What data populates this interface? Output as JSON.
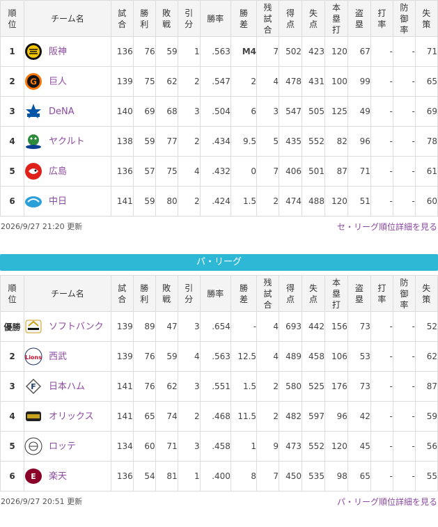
{
  "headers": [
    "順\n位",
    "チーム名",
    "試\n合",
    "勝\n利",
    "敗\n戦",
    "引\n分",
    "勝率",
    "勝\n差",
    "残\n試\n合",
    "得\n点",
    "失\n点",
    "本\n塁\n打",
    "盗\n塁",
    "打\n率",
    "防\n御\n率",
    "失\n策"
  ],
  "central": {
    "rows": [
      {
        "rank": "1",
        "team": "阪神",
        "logo": "tigers",
        "games": "136",
        "wins": "76",
        "losses": "59",
        "draws": "1",
        "pct": ".563",
        "gb": "M4",
        "remaining": "7",
        "runs": "502",
        "allowed": "423",
        "hr": "120",
        "sb": "67",
        "avg": "-",
        "era": "-",
        "errors": "71"
      },
      {
        "rank": "2",
        "team": "巨人",
        "logo": "giants",
        "games": "139",
        "wins": "75",
        "losses": "62",
        "draws": "2",
        "pct": ".547",
        "gb": "2",
        "remaining": "4",
        "runs": "478",
        "allowed": "431",
        "hr": "100",
        "sb": "99",
        "avg": "-",
        "era": "-",
        "errors": "65"
      },
      {
        "rank": "3",
        "team": "DeNA",
        "logo": "baystars",
        "games": "140",
        "wins": "69",
        "losses": "68",
        "draws": "3",
        "pct": ".504",
        "gb": "6",
        "remaining": "3",
        "runs": "547",
        "allowed": "505",
        "hr": "125",
        "sb": "49",
        "avg": "-",
        "era": "-",
        "errors": "69"
      },
      {
        "rank": "4",
        "team": "ヤクルト",
        "logo": "swallows",
        "games": "138",
        "wins": "59",
        "losses": "77",
        "draws": "2",
        "pct": ".434",
        "gb": "9.5",
        "remaining": "5",
        "runs": "435",
        "allowed": "552",
        "hr": "82",
        "sb": "96",
        "avg": "-",
        "era": "-",
        "errors": "78"
      },
      {
        "rank": "5",
        "team": "広島",
        "logo": "carp",
        "games": "136",
        "wins": "57",
        "losses": "75",
        "draws": "4",
        "pct": ".432",
        "gb": "0",
        "remaining": "7",
        "runs": "406",
        "allowed": "501",
        "hr": "87",
        "sb": "71",
        "avg": "-",
        "era": "-",
        "errors": "61"
      },
      {
        "rank": "6",
        "team": "中日",
        "logo": "dragons",
        "games": "141",
        "wins": "59",
        "losses": "80",
        "draws": "2",
        "pct": ".424",
        "gb": "1.5",
        "remaining": "2",
        "runs": "474",
        "allowed": "488",
        "hr": "120",
        "sb": "51",
        "avg": "-",
        "era": "-",
        "errors": "60"
      }
    ],
    "updated": "2026/9/27 21:20 更新",
    "detail_link": "セ・リーグ順位詳細を見る"
  },
  "pacific": {
    "title": "パ・リーグ",
    "rows": [
      {
        "rank": "優勝",
        "team": "ソフトバンク",
        "logo": "hawks",
        "games": "139",
        "wins": "89",
        "losses": "47",
        "draws": "3",
        "pct": ".654",
        "gb": "-",
        "remaining": "4",
        "runs": "693",
        "allowed": "442",
        "hr": "156",
        "sb": "73",
        "avg": "-",
        "era": "-",
        "errors": "52"
      },
      {
        "rank": "2",
        "team": "西武",
        "logo": "lions",
        "games": "139",
        "wins": "76",
        "losses": "59",
        "draws": "4",
        "pct": ".563",
        "gb": "12.5",
        "remaining": "4",
        "runs": "489",
        "allowed": "458",
        "hr": "106",
        "sb": "53",
        "avg": "-",
        "era": "-",
        "errors": "62"
      },
      {
        "rank": "3",
        "team": "日本ハム",
        "logo": "fighters",
        "games": "141",
        "wins": "76",
        "losses": "62",
        "draws": "3",
        "pct": ".551",
        "gb": "1.5",
        "remaining": "2",
        "runs": "580",
        "allowed": "525",
        "hr": "176",
        "sb": "73",
        "avg": "-",
        "era": "-",
        "errors": "87"
      },
      {
        "rank": "4",
        "team": "オリックス",
        "logo": "buffaloes",
        "games": "141",
        "wins": "65",
        "losses": "74",
        "draws": "2",
        "pct": ".468",
        "gb": "11.5",
        "remaining": "2",
        "runs": "482",
        "allowed": "597",
        "hr": "96",
        "sb": "42",
        "avg": "-",
        "era": "-",
        "errors": "59"
      },
      {
        "rank": "5",
        "team": "ロッテ",
        "logo": "marines",
        "games": "134",
        "wins": "60",
        "losses": "71",
        "draws": "3",
        "pct": ".458",
        "gb": "1",
        "remaining": "9",
        "runs": "473",
        "allowed": "552",
        "hr": "120",
        "sb": "45",
        "avg": "-",
        "era": "-",
        "errors": "56"
      },
      {
        "rank": "6",
        "team": "楽天",
        "logo": "eagles",
        "games": "136",
        "wins": "54",
        "losses": "81",
        "draws": "1",
        "pct": ".400",
        "gb": "8",
        "remaining": "7",
        "runs": "450",
        "allowed": "535",
        "hr": "98",
        "sb": "65",
        "avg": "-",
        "era": "-",
        "errors": "55"
      }
    ],
    "updated": "2026/9/27 20:51 更新",
    "detail_link": "パ・リーグ順位詳細を見る"
  },
  "colors": {
    "accent": "#2eb8d6",
    "link": "#8c4aa0",
    "header_bg": "#f4f4f4",
    "border": "#dcdcdc"
  }
}
